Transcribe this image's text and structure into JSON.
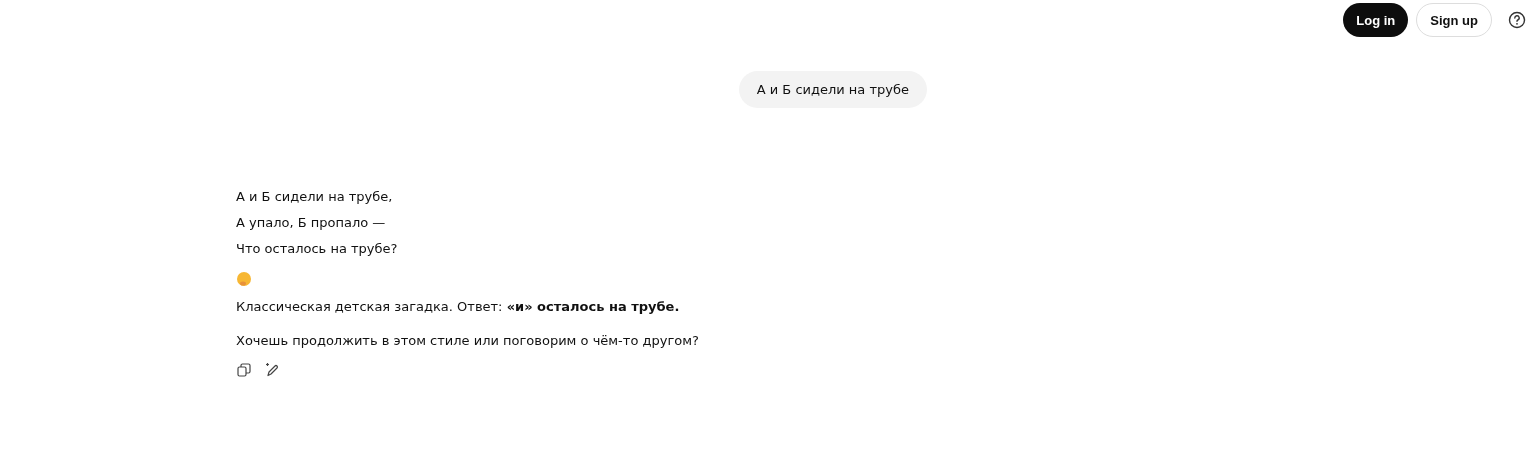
{
  "header": {
    "buttons": [
      {
        "label": "Log in",
        "kind": "primary"
      },
      {
        "label": "Sign up",
        "kind": "secondary"
      }
    ]
  },
  "user_message": "А и Б сидели на трубе",
  "reply": {
    "poem": [
      "А и Б сидели на трубе,",
      "А упало, Б пропало —",
      "Что осталось на трубе?"
    ],
    "answer": "Классическая детская загадка. Ответ: **«и» осталось на трубе.**",
    "question": "Хочешь продолжить в этом стиле или поговорим о чём-то другом?"
  }
}
